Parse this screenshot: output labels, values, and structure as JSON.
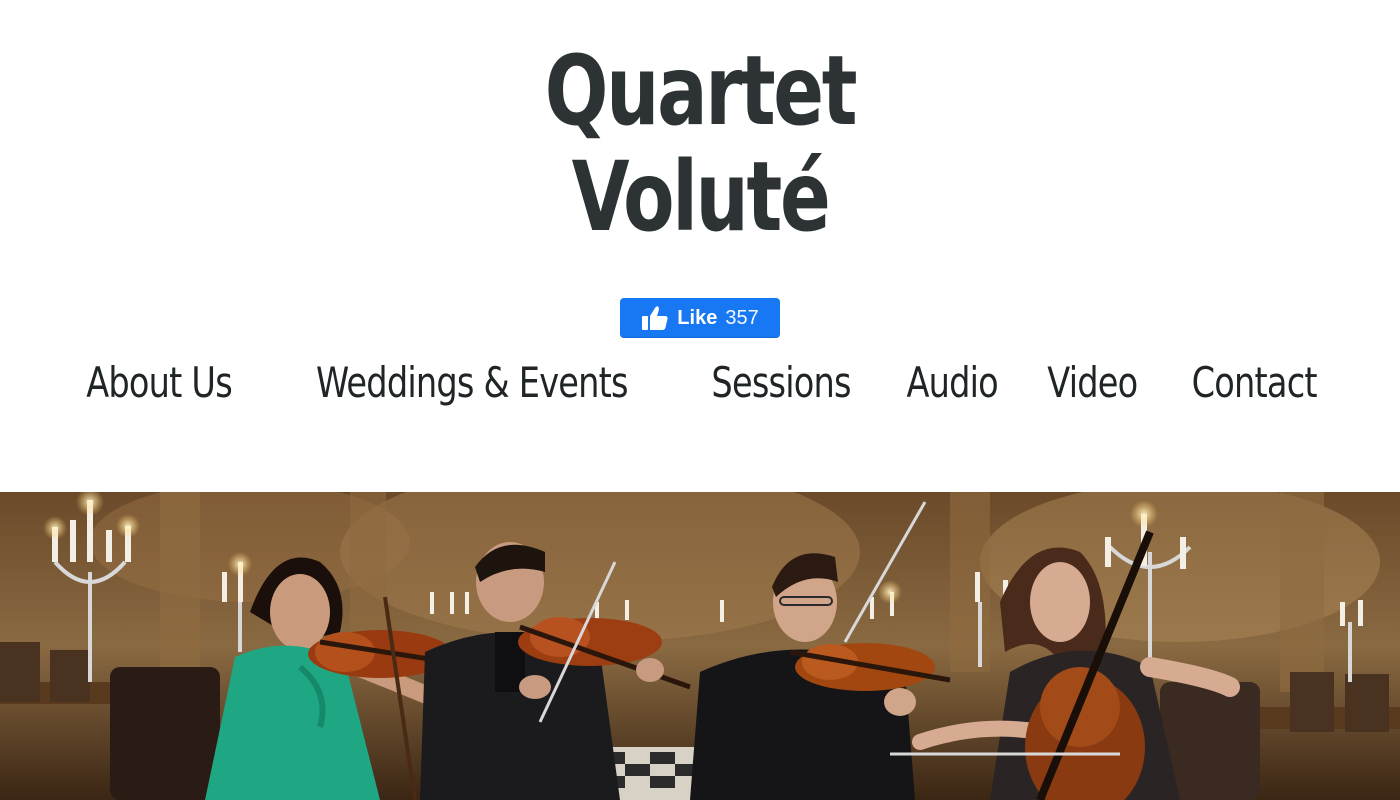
{
  "site": {
    "title_line1": "Quartet",
    "title_line2": "Voluté"
  },
  "facebook": {
    "like_label": "Like",
    "like_count": "357",
    "icon": "thumbs-up-icon",
    "color": "#1877f2"
  },
  "nav": {
    "items": [
      {
        "label": "About Us"
      },
      {
        "label": "Weddings & Events"
      },
      {
        "label": "Sessions"
      },
      {
        "label": "Audio"
      },
      {
        "label": "Video"
      },
      {
        "label": "Contact"
      }
    ]
  },
  "colors": {
    "title": "#2d3335",
    "nav_text": "#1f2426",
    "background": "#ffffff"
  }
}
